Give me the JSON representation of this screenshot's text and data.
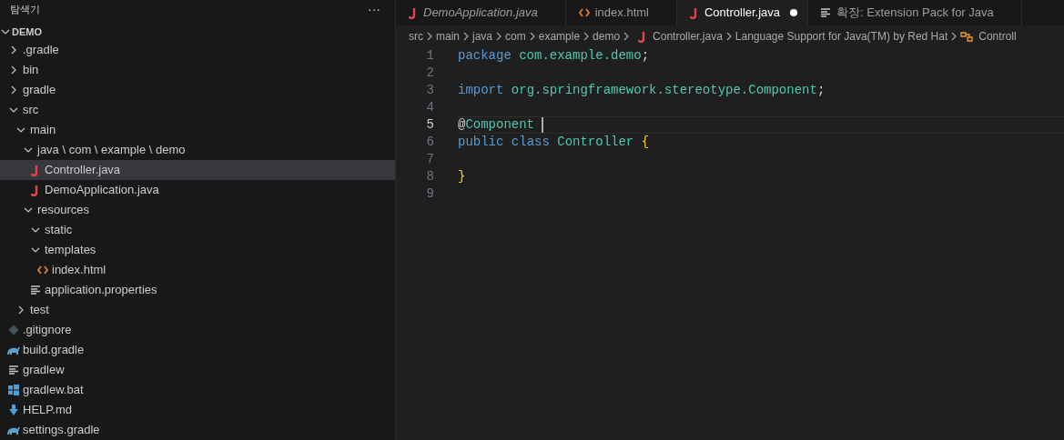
{
  "sidebar": {
    "title": "탐색기",
    "more": "···",
    "root": {
      "label": "DEMO",
      "expanded": true
    },
    "tree": [
      {
        "label": ".gradle",
        "kind": "folder",
        "expanded": false,
        "selected": false
      },
      {
        "label": "bin",
        "kind": "folder",
        "expanded": false,
        "selected": false
      },
      {
        "label": "gradle",
        "kind": "folder",
        "expanded": false,
        "selected": false
      },
      {
        "label": "src",
        "kind": "folder",
        "expanded": true,
        "selected": false,
        "children": [
          {
            "label": "main",
            "kind": "folder",
            "expanded": true,
            "selected": false,
            "children": [
              {
                "label": "java \\ com \\ example \\ demo",
                "kind": "folder",
                "expanded": true,
                "selected": false,
                "children": [
                  {
                    "label": "Controller.java",
                    "kind": "java",
                    "selected": true
                  },
                  {
                    "label": "DemoApplication.java",
                    "kind": "java",
                    "selected": false
                  }
                ]
              },
              {
                "label": "resources",
                "kind": "folder",
                "expanded": true,
                "selected": false,
                "children": [
                  {
                    "label": "static",
                    "kind": "folder",
                    "expanded": true,
                    "selected": false
                  },
                  {
                    "label": "templates",
                    "kind": "folder",
                    "expanded": true,
                    "selected": false,
                    "children": [
                      {
                        "label": "index.html",
                        "kind": "html",
                        "selected": false
                      }
                    ]
                  },
                  {
                    "label": "application.properties",
                    "kind": "text",
                    "selected": false
                  }
                ]
              }
            ]
          },
          {
            "label": "test",
            "kind": "folder",
            "expanded": false,
            "selected": false
          }
        ]
      },
      {
        "label": ".gitignore",
        "kind": "git",
        "selected": false
      },
      {
        "label": "build.gradle",
        "kind": "gradle",
        "selected": false
      },
      {
        "label": "gradlew",
        "kind": "text",
        "selected": false
      },
      {
        "label": "gradlew.bat",
        "kind": "windows",
        "selected": false
      },
      {
        "label": "HELP.md",
        "kind": "markdown",
        "selected": false
      },
      {
        "label": "settings.gradle",
        "kind": "gradle",
        "selected": false
      }
    ]
  },
  "tabs": [
    {
      "label": "DemoApplication.java",
      "kind": "java",
      "selected": false,
      "preview": true,
      "modified": false
    },
    {
      "label": "index.html",
      "kind": "html",
      "selected": false,
      "preview": false,
      "modified": false
    },
    {
      "label": "Controller.java",
      "kind": "java",
      "selected": true,
      "preview": false,
      "modified": true
    },
    {
      "label": "확장: Extension Pack for Java",
      "kind": "text",
      "selected": false,
      "preview": false,
      "modified": false
    }
  ],
  "breadcrumbs": [
    {
      "label": "src",
      "kind": "plain"
    },
    {
      "label": "main",
      "kind": "plain"
    },
    {
      "label": "java",
      "kind": "plain"
    },
    {
      "label": "com",
      "kind": "plain"
    },
    {
      "label": "example",
      "kind": "plain"
    },
    {
      "label": "demo",
      "kind": "plain"
    },
    {
      "label": "Controller.java",
      "kind": "java"
    },
    {
      "label": "Language Support for Java(TM) by Red Hat",
      "kind": "plain"
    },
    {
      "label": "Controll",
      "kind": "class"
    }
  ],
  "code": [
    {
      "number": "1",
      "current": false,
      "tokens": [
        {
          "text": "package",
          "kind": "keyword"
        },
        {
          "text": " com.example.demo",
          "kind": "type"
        },
        {
          "text": ";",
          "kind": "plain"
        }
      ]
    },
    {
      "number": "2",
      "current": false
    },
    {
      "number": "3",
      "current": false,
      "tokens": [
        {
          "text": "import",
          "kind": "keyword"
        },
        {
          "text": " org.springframework.stereotype.Component",
          "kind": "type"
        },
        {
          "text": ";",
          "kind": "plain"
        }
      ]
    },
    {
      "number": "4",
      "current": false
    },
    {
      "number": "5",
      "current": true,
      "tokens": [
        {
          "text": "@",
          "kind": "plain"
        },
        {
          "text": "Component",
          "kind": "type"
        }
      ]
    },
    {
      "number": "6",
      "current": false,
      "tokens": [
        {
          "text": "public",
          "kind": "keyword"
        },
        {
          "text": " class",
          "kind": "keyword"
        },
        {
          "text": " Controller",
          "kind": "type"
        },
        {
          "text": " {",
          "kind": "bracket"
        }
      ]
    },
    {
      "number": "7",
      "current": false
    },
    {
      "number": "8",
      "current": false,
      "tokens": [
        {
          "text": "}",
          "kind": "bracket"
        }
      ]
    },
    {
      "number": "9",
      "current": false
    }
  ]
}
